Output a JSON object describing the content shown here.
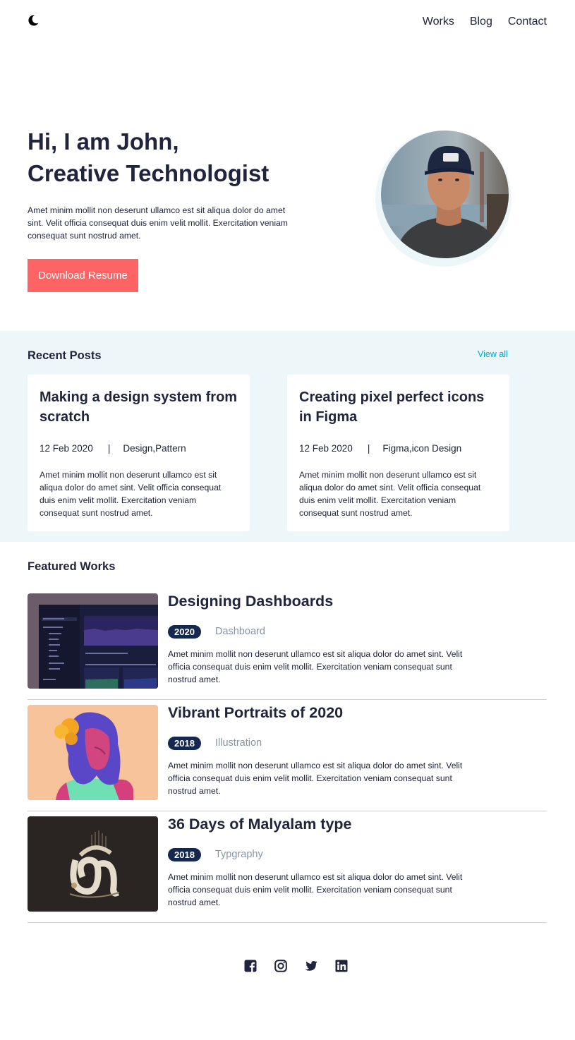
{
  "header": {
    "logo_icon": "moon-icon",
    "nav": [
      {
        "label": "Works"
      },
      {
        "label": "Blog"
      },
      {
        "label": "Contact"
      }
    ]
  },
  "hero": {
    "title_line1": "Hi, I am John,",
    "title_line2": "Creative Technologist",
    "description": "Amet minim mollit non deserunt ullamco est sit aliqua dolor do amet sint. Velit officia consequat duis enim velit mollit. Exercitation veniam consequat sunt nostrud amet.",
    "button_label": "Download Resume",
    "accent_color": "#ff6464"
  },
  "recent_posts": {
    "heading": "Recent Posts",
    "view_all": "View all",
    "posts": [
      {
        "title": "Making a design system from scratch",
        "date": "12 Feb 2020",
        "separator": "|",
        "tags": "Design,Pattern",
        "description": "Amet minim mollit non deserunt ullamco est sit aliqua dolor do amet sint. Velit officia consequat duis enim velit mollit. Exercitation veniam consequat sunt nostrud amet."
      },
      {
        "title": "Creating pixel perfect icons in Figma",
        "date": "12 Feb 2020",
        "separator": "|",
        "tags": "Figma,icon Design",
        "description": "Amet minim mollit non deserunt ullamco est sit aliqua dolor do amet sint. Velit officia consequat duis enim velit mollit. Exercitation veniam consequat sunt nostrud amet."
      }
    ]
  },
  "featured_works": {
    "heading": "Featured Works",
    "works": [
      {
        "title": "Designing Dashboards",
        "year": "2020",
        "category": "Dashboard",
        "description": "Amet minim mollit non deserunt ullamco est sit aliqua dolor do amet sint. Velit officia consequat duis enim velit mollit. Exercitation veniam consequat sunt nostrud amet."
      },
      {
        "title": "Vibrant Portraits of 2020",
        "year": "2018",
        "category": "Illustration",
        "description": "Amet minim mollit non deserunt ullamco est sit aliqua dolor do amet sint. Velit officia consequat duis enim velit mollit. Exercitation veniam consequat sunt nostrud amet."
      },
      {
        "title": "36 Days of Malyalam type",
        "year": "2018",
        "category": "Typgraphy",
        "description": "Amet minim mollit non deserunt ullamco est sit aliqua dolor do amet sint. Velit officia consequat duis enim velit mollit. Exercitation veniam consequat sunt nostrud amet."
      }
    ]
  },
  "footer": {
    "socials": [
      "facebook-icon",
      "instagram-icon",
      "twitter-icon",
      "linkedin-icon"
    ]
  }
}
